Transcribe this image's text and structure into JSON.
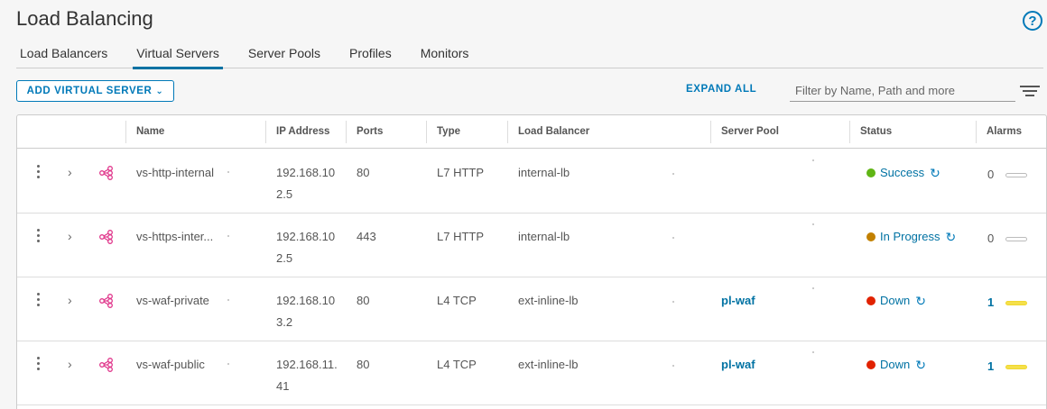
{
  "page": {
    "title": "Load Balancing",
    "help": "?"
  },
  "tabs": [
    "Load Balancers",
    "Virtual Servers",
    "Server Pools",
    "Profiles",
    "Monitors"
  ],
  "toolbar": {
    "add_label": "ADD VIRTUAL SERVER",
    "add_caret": "⌄",
    "expand_label": "EXPAND ALL",
    "filter_placeholder": "Filter by Name, Path and more"
  },
  "columns": {
    "name": "Name",
    "ip": "IP Address",
    "ports": "Ports",
    "type": "Type",
    "lb": "Load Balancer",
    "pool": "Server Pool",
    "status": "Status",
    "alarms": "Alarms"
  },
  "rows": [
    {
      "name": "vs-http-internal",
      "ip": "192.168.102.5",
      "ports": "80",
      "type": "L7 HTTP",
      "lb": "internal-lb",
      "pool": "",
      "status": "Success",
      "status_color": "#60b515",
      "alarms": "0"
    },
    {
      "name": "vs-https-inter...",
      "ip": "192.168.102.5",
      "ports": "443",
      "type": "L7 HTTP",
      "lb": "internal-lb",
      "pool": "",
      "status": "In Progress",
      "status_color": "#c28000",
      "alarms": "0"
    },
    {
      "name": "vs-waf-private",
      "ip": "192.168.103.2",
      "ports": "80",
      "type": "L4 TCP",
      "lb": "ext-inline-lb",
      "pool": "pl-waf",
      "status": "Down",
      "status_color": "#e12200",
      "alarms": "1"
    },
    {
      "name": "vs-waf-public",
      "ip": "192.168.11.41",
      "ports": "80",
      "type": "L4 TCP",
      "lb": "ext-inline-lb",
      "pool": "pl-waf",
      "status": "Down",
      "status_color": "#e12200",
      "alarms": "1"
    }
  ],
  "colors": {
    "accent": "#0079b8",
    "vs_icon": "#e0368b",
    "alarm_active": "#f5e04a"
  }
}
